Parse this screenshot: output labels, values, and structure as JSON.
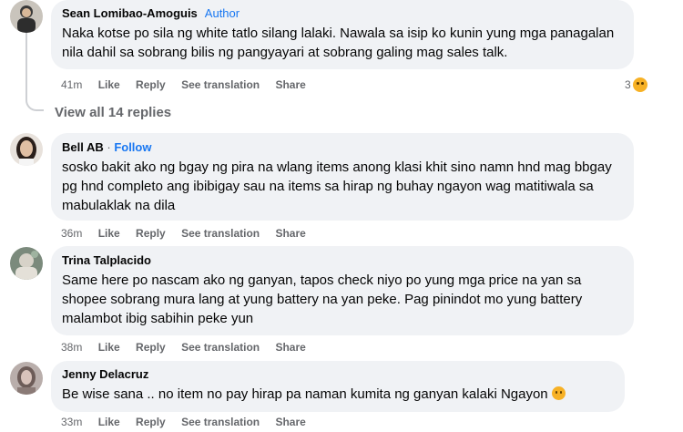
{
  "comments": [
    {
      "name": "Sean Lomibao-Amoguis",
      "badge": "Author",
      "text": "Naka kotse po sila ng white tatlo silang lalaki. Nawala sa isip ko kunin yung mga panagalan nila dahil sa sobrang bilis ng pangyayari at sobrang galing mag sales talk.",
      "time": "41m",
      "like": "Like",
      "reply": "Reply",
      "see_translation": "See translation",
      "share": "Share",
      "reaction_count": "3",
      "reaction_icon": "sad-face-icon"
    },
    {
      "name": "Bell AB",
      "dot": " · ",
      "follow": "Follow",
      "text": "sosko bakit ako ng bgay ng pira na wlang items anong klasi khit sino namn hnd mag bbgay pg hnd completo ang ibibigay sau na items sa hirap ng buhay ngayon wag matitiwala sa mabulaklak na dila",
      "time": "36m",
      "like": "Like",
      "reply": "Reply",
      "see_translation": "See translation",
      "share": "Share"
    },
    {
      "name": "Trina Talplacido",
      "text": "Same here po nascam ako ng ganyan, tapos check niyo po yung mga price na yan sa shopee sobrang mura lang at yung battery na yan peke. Pag pinindot mo yung battery malambot ibig sabihin peke yun",
      "time": "38m",
      "like": "Like",
      "reply": "Reply",
      "see_translation": "See translation",
      "share": "Share"
    },
    {
      "name": "Jenny Delacruz",
      "text": "Be wise sana .. no item no pay hirap pa naman kumita ng ganyan kalaki Ngayon",
      "text_emoji": "surprised-face-icon",
      "time": "33m",
      "like": "Like",
      "reply": "Reply",
      "see_translation": "See translation",
      "share": "Share"
    }
  ],
  "view_replies": "View all 14 replies",
  "colors": {
    "bubble": "#f0f2f5",
    "link": "#1877f2",
    "muted": "#65676b",
    "emoji": "#f7b125"
  }
}
